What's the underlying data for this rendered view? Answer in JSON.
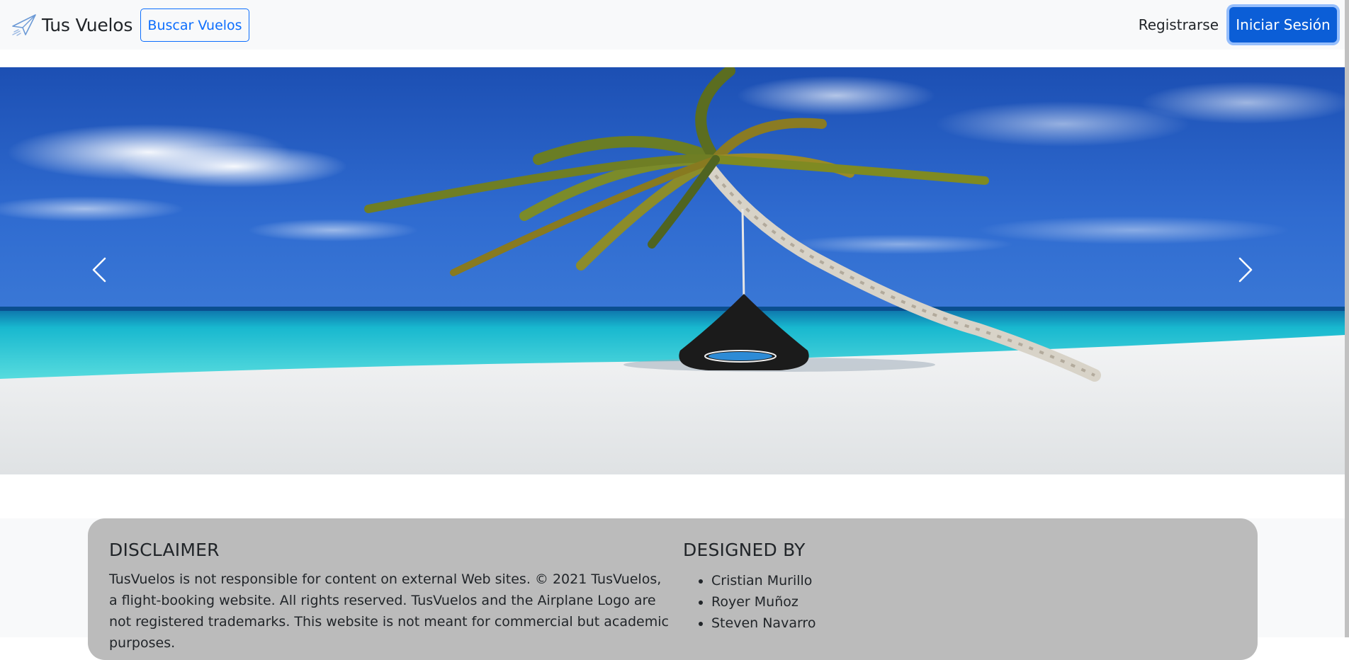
{
  "navbar": {
    "brand_text": "Tus Vuelos",
    "brand_icon": "paper-plane-icon",
    "search_button": "Buscar Vuelos",
    "register_link": "Registrarse",
    "login_button": "Iniciar Sesión"
  },
  "carousel": {
    "prev_icon": "chevron-left-icon",
    "next_icon": "chevron-right-icon"
  },
  "footer": {
    "disclaimer_title": "DISCLAIMER",
    "disclaimer_text": "TusVuelos is not responsible for content on external Web sites. © 2021 TusVuelos, a flight-booking website. All rights reserved. TusVuelos and the Airplane Logo are not registered trademarks. This website is not meant for commercial but academic purposes.",
    "designed_title": "DESIGNED BY",
    "designers": [
      "Cristian Murillo",
      "Royer Muñoz",
      "Steven Navarro"
    ]
  },
  "colors": {
    "primary": "#0d6efd",
    "navbar_bg": "#f8f9fa",
    "footer_card": "#bbbbbb"
  }
}
